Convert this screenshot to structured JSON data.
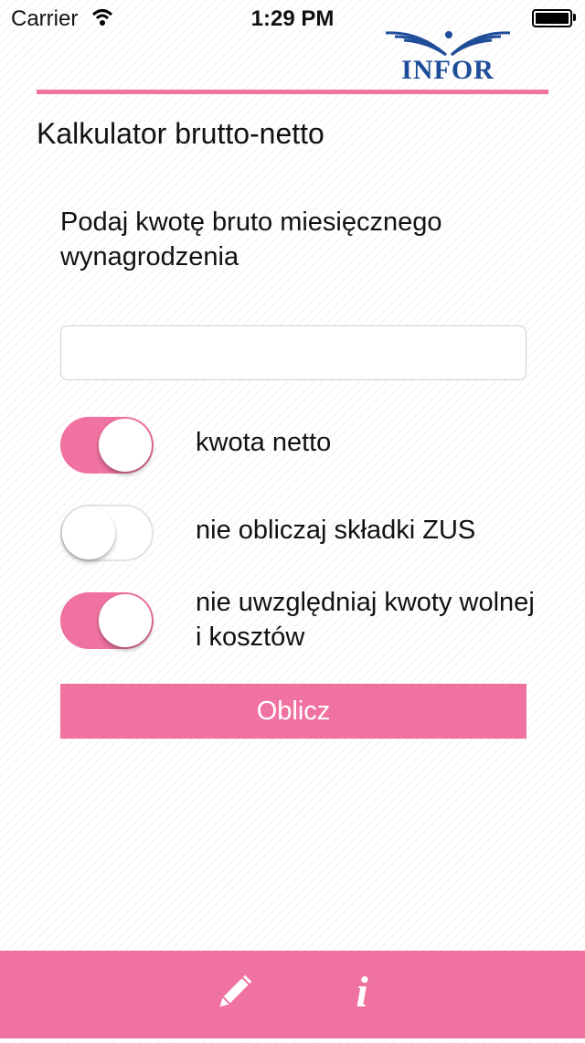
{
  "status": {
    "carrier": "Carrier",
    "time": "1:29 PM",
    "battery_level": 1.0
  },
  "brand": {
    "logo_text": "INFOR",
    "accent_color": "#ef72a0",
    "logo_color": "#1f4d99"
  },
  "page": {
    "title": "Kalkulator brutto-netto",
    "prompt": "Podaj kwotę bruto miesięcznego wynagrodzenia",
    "amount_value": "",
    "amount_placeholder": ""
  },
  "options": [
    {
      "label": "kwota netto",
      "on": true
    },
    {
      "label": "nie obliczaj składki ZUS",
      "on": false
    },
    {
      "label": "nie uwzględniaj kwoty wolnej i kosztów",
      "on": true
    }
  ],
  "actions": {
    "calculate_label": "Oblicz"
  },
  "tabbar": {
    "items": [
      {
        "icon": "pencil-icon"
      },
      {
        "icon": "info-icon",
        "glyph": "i"
      }
    ]
  }
}
